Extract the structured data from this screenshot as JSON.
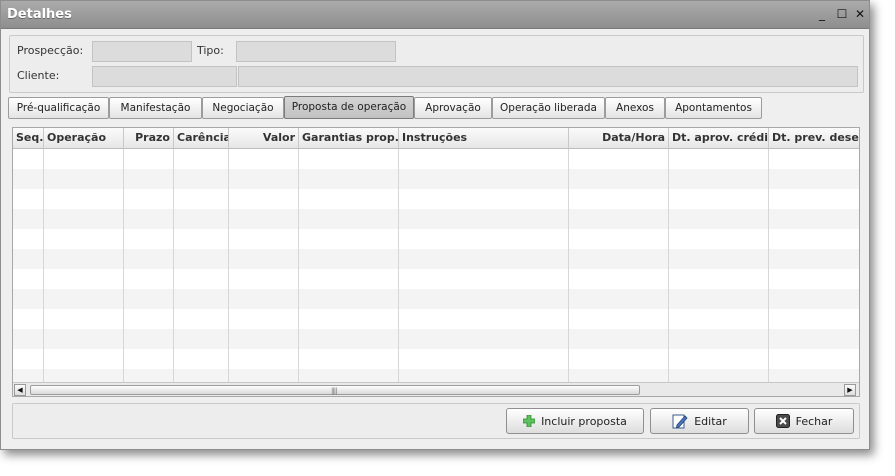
{
  "window": {
    "title": "Detalhes",
    "controls": {
      "minimize": "_",
      "maximize": "☐",
      "close": "✕"
    }
  },
  "header": {
    "prospeccao_label": "Prospecção:",
    "tipo_label": "Tipo:",
    "cliente_label": "Cliente:"
  },
  "tabs": [
    {
      "label": "Pré-qualificação"
    },
    {
      "label": "Manifestação"
    },
    {
      "label": "Negociação"
    },
    {
      "label": "Proposta de operação",
      "active": true
    },
    {
      "label": "Aprovação"
    },
    {
      "label": "Operação liberada"
    },
    {
      "label": "Anexos"
    },
    {
      "label": "Apontamentos"
    }
  ],
  "grid": {
    "columns": [
      "Seq.",
      "Operação",
      "Prazo",
      "Carência",
      "Valor",
      "Garantias prop...",
      "Instruções",
      "Data/Hora",
      "Dt. aprov. crédito",
      "Dt. prev. desem..."
    ],
    "rows": []
  },
  "scrollbar": {
    "left_arrow": "◀",
    "right_arrow": "▶",
    "grip": "||||"
  },
  "footer": {
    "incluir_label": "Incluir proposta",
    "editar_label": "Editar",
    "fechar_label": "Fechar"
  },
  "icons": {
    "incluir": "plus-icon",
    "editar": "pencil-icon",
    "fechar": "close-x-icon"
  },
  "colors": {
    "titlebar": "#9d9d9d",
    "window_bg": "#efefef",
    "field_bg": "#dcdcdc",
    "plus_green": "#3aa33a"
  }
}
